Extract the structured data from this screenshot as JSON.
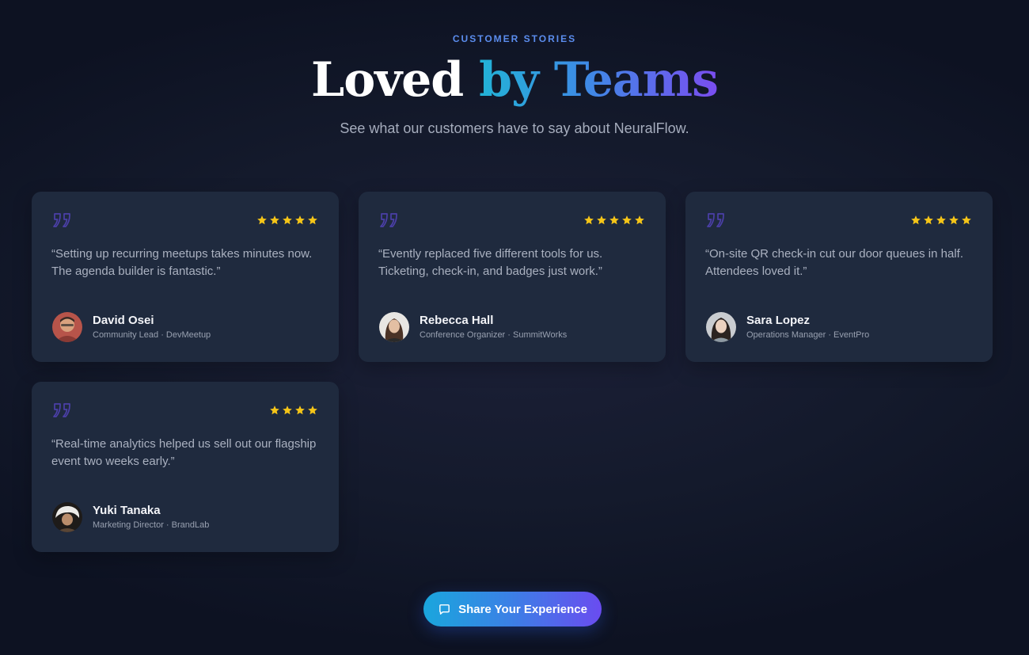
{
  "header": {
    "eyebrow": "CUSTOMER STORIES",
    "title_plain": "Loved",
    "title_highlight": "by Teams",
    "subtitle": "See what our customers have to say about NeuralFlow."
  },
  "colors": {
    "accent": "#5b8dee",
    "star": "#f5c518",
    "quote_icon": "#4b3fa8",
    "card_bg": "#1f2a3e"
  },
  "testimonials": [
    {
      "rating": 5,
      "quote": "“Setting up recurring meetups takes minutes now. The agenda builder is fantastic.”",
      "name": "David Osei",
      "role": "Community Lead · DevMeetup"
    },
    {
      "rating": 5,
      "quote": "“Evently replaced five different tools for us. Ticketing, check-in, and badges just work.”",
      "name": "Rebecca Hall",
      "role": "Conference Organizer · SummitWorks"
    },
    {
      "rating": 5,
      "quote": "“On-site QR check-in cut our door queues in half. Attendees loved it.”",
      "name": "Sara Lopez",
      "role": "Operations Manager · EventPro"
    },
    {
      "rating": 4,
      "quote": "“Real-time analytics helped us sell out our flagship event two weeks early.”",
      "name": "Yuki Tanaka",
      "role": "Marketing Director · BrandLab"
    }
  ],
  "cta": {
    "label": "Share Your Experience",
    "icon": "chat-bubble-icon"
  }
}
